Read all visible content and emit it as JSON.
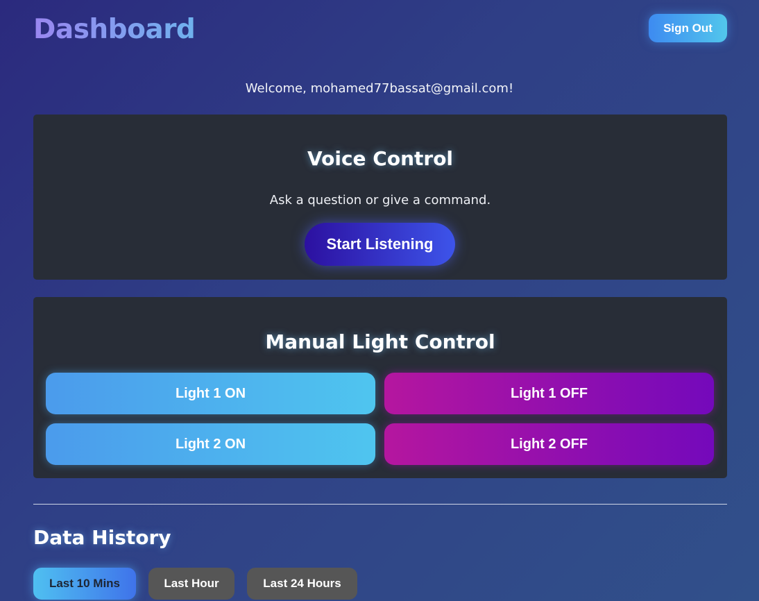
{
  "header": {
    "title": "Dashboard",
    "sign_out_label": "Sign Out"
  },
  "welcome_text": "Welcome, mohamed77bassat@gmail.com!",
  "voice_control": {
    "title": "Voice Control",
    "subtitle": "Ask a question or give a command.",
    "button_label": "Start Listening"
  },
  "manual_control": {
    "title": "Manual Light Control",
    "buttons": [
      {
        "label": "Light 1 ON"
      },
      {
        "label": "Light 1 OFF"
      },
      {
        "label": "Light 2 ON"
      },
      {
        "label": "Light 2 OFF"
      }
    ]
  },
  "data_history": {
    "title": "Data History",
    "ranges": [
      {
        "label": "Last 10 Mins",
        "active": true
      },
      {
        "label": "Last Hour",
        "active": false
      },
      {
        "label": "Last 24 Hours",
        "active": false
      }
    ]
  },
  "colors": {
    "accent_blue": "#4b9bec",
    "accent_purple": "#b5169f",
    "panel_bg": "#282d37"
  }
}
